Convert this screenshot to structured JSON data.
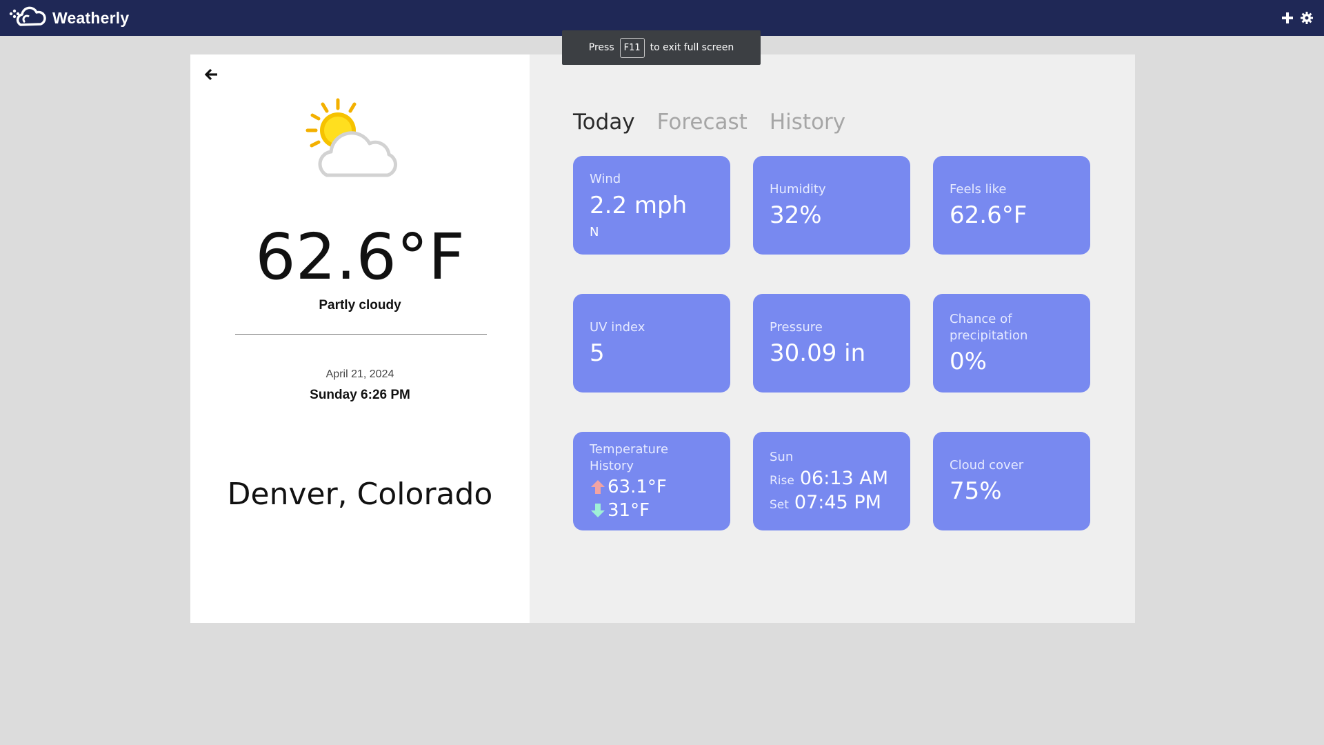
{
  "app": {
    "name": "Weatherly"
  },
  "toast": {
    "prefix": "Press",
    "key": "F11",
    "suffix": "to exit full screen"
  },
  "current": {
    "temperature": "62.6°F",
    "condition": "Partly cloudy",
    "date": "April 21, 2024",
    "day_time": "Sunday 6:26 PM",
    "location": "Denver, Colorado"
  },
  "tabs": [
    {
      "label": "Today",
      "active": true
    },
    {
      "label": "Forecast",
      "active": false
    },
    {
      "label": "History",
      "active": false
    }
  ],
  "tiles": {
    "wind": {
      "label": "Wind",
      "value": "2.2 mph",
      "direction": "N"
    },
    "humidity": {
      "label": "Humidity",
      "value": "32%"
    },
    "feels_like": {
      "label": "Feels like",
      "value": "62.6°F"
    },
    "uv": {
      "label": "UV index",
      "value": "5"
    },
    "pressure": {
      "label": "Pressure",
      "value": "30.09 in"
    },
    "precip": {
      "label": "Chance of precipitation",
      "value": "0%"
    },
    "temp_history": {
      "label": "Temperature History",
      "high": "63.1°F",
      "low": "31°F"
    },
    "sun": {
      "label": "Sun",
      "rise_label": "Rise",
      "rise": "06:13 AM",
      "set_label": "Set",
      "set": "07:45 PM"
    },
    "cloud": {
      "label": "Cloud cover",
      "value": "75%"
    }
  },
  "icons": {
    "logo": "cloud-logo-icon",
    "add": "plus-icon",
    "settings": "gear-icon",
    "back": "arrow-left-icon",
    "weather": "partly-cloudy-icon",
    "high": "arrow-up-icon",
    "low": "arrow-down-icon"
  },
  "colors": {
    "topbar": "#1f2856",
    "tile": "#7889f0",
    "arrow_up": "#f2a3a3",
    "arrow_down": "#9ff0d6"
  }
}
